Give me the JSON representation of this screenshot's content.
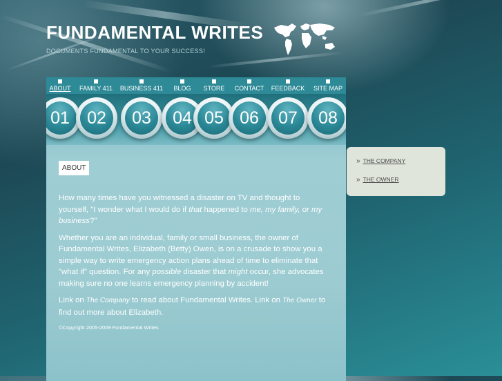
{
  "header": {
    "title": "FUNDAMENTAL WRITES",
    "tagline": "DOCUMENTS FUNDAMENTAL TO YOUR SUCCESS!",
    "logo_icon": "world-map-icon"
  },
  "nav": [
    {
      "label": "ABOUT",
      "number": "01",
      "active": true
    },
    {
      "label": "FAMILY 411",
      "number": "02"
    },
    {
      "label": "BUSINESS 411",
      "number": "03"
    },
    {
      "label": "BLOG",
      "number": "04"
    },
    {
      "label": "STORE",
      "number": "05"
    },
    {
      "label": "CONTACT",
      "number": "06"
    },
    {
      "label": "FEEDBACK",
      "number": "07"
    },
    {
      "label": "SITE MAP",
      "number": "08"
    }
  ],
  "main": {
    "section_label": "ABOUT",
    "p1": {
      "a": "How many times have you witnessed a disaster on TV and thought to yourself, \"I wonder what I would do if ",
      "b": "that",
      "c": " happened to ",
      "d": "me, my family, or my business",
      "e": "?\""
    },
    "p2": {
      "a": "Whether you are an individual, family or small business, the owner of Fundamental Writes, Elizabeth (Betty) Owen, is on a crusade to show you a simple way to write emergency action plans ahead of time to eliminate that \"what if\" question. For any ",
      "b": "possible",
      "c": " disaster that ",
      "d": "might",
      "e": " occur, she advocates making sure no one learns emergency planning by accident!"
    },
    "p3": {
      "a": "Link on ",
      "b": "The Company",
      "c": " to read about Fundamental Writes.  Link on ",
      "d": "The Owner",
      "e": " to find out more about Elizabeth."
    },
    "copyright": "©Copyright 2005-2009 Fundamental Writes"
  },
  "sidebar": {
    "arrow": "»",
    "links": [
      "THE COMPANY",
      "THE OWNER"
    ]
  },
  "colors": {
    "nav_bar": "#2e8a97",
    "panel": "#9fcdd4",
    "sidebar": "#dfe5db"
  }
}
